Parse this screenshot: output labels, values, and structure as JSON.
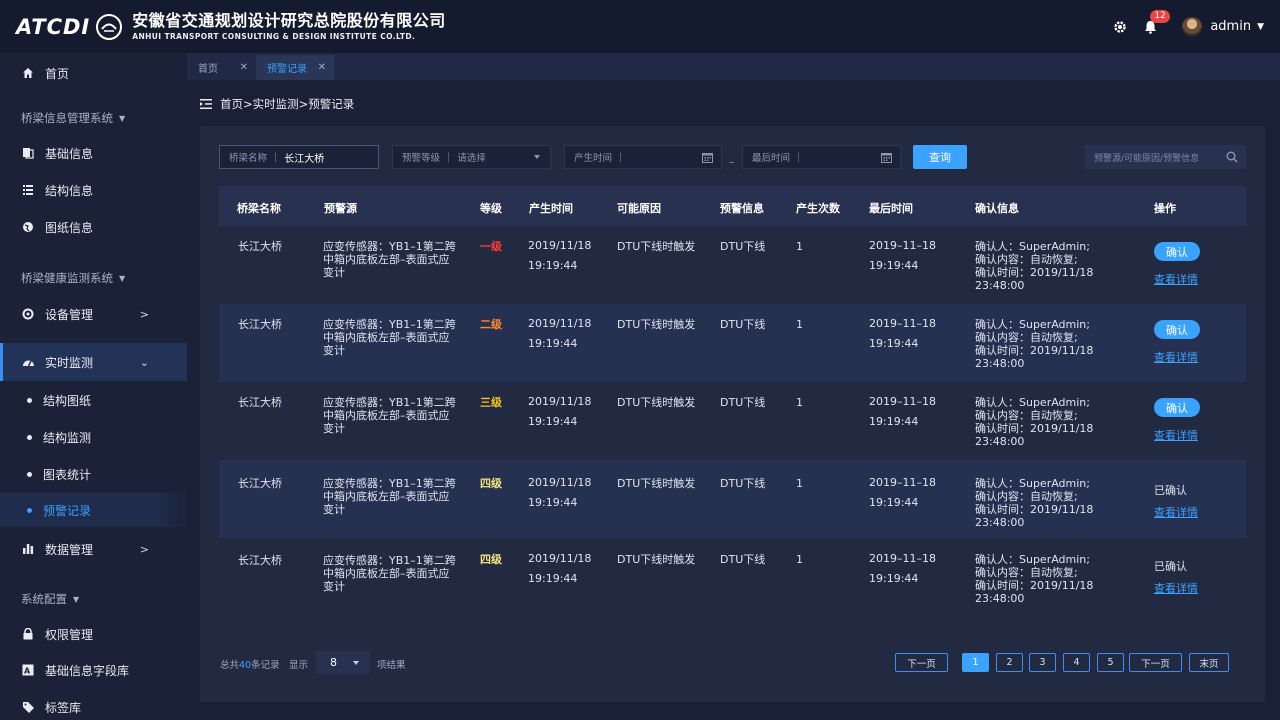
{
  "header": {
    "logo_text": "ATCDI",
    "company_cn": "安徽省交通规划设计研究总院股份有限公司",
    "company_en": "ANHUI TRANSPORT CONSULTING & DESIGN INSTITUTE CO.LTD.",
    "notification_count": "12",
    "username": "admin"
  },
  "sidebar": {
    "home": "首页",
    "group1": "桥梁信息管理系统",
    "basic_info": "基础信息",
    "structure_info": "结构信息",
    "drawing_info": "图纸信息",
    "group2": "桥梁健康监测系统",
    "device_mgmt": "设备管理",
    "realtime": "实时监测",
    "sub_items": [
      "结构图纸",
      "结构监测",
      "图表统计",
      "预警记录"
    ],
    "data_mgmt": "数据管理",
    "group3": "系统配置",
    "permission": "权限管理",
    "field_lib": "基础信息字段库",
    "tag_lib": "标签库"
  },
  "tabs": [
    {
      "label": "首页"
    },
    {
      "label": "预警记录"
    }
  ],
  "breadcrumb": "首页>实时监测>预警记录",
  "filters": {
    "bridge_label": "桥梁名称",
    "bridge_value": "长江大桥",
    "level_label": "预警等级",
    "level_placeholder": "请选择",
    "start_label": "产生时间",
    "end_label": "最后时间",
    "query_button": "查询",
    "search_placeholder": "预警源/可能原因/预警信息"
  },
  "table": {
    "headers": [
      "桥梁名称",
      "预警源",
      "等级",
      "产生时间",
      "可能原因",
      "预警信息",
      "产生次数",
      "最后时间",
      "确认信息",
      "操作"
    ],
    "rows": [
      {
        "bridge": "长江大桥",
        "source": [
          "应变传感器：YB1–1第二跨",
          "中箱内底板左部–表面式应",
          "变计"
        ],
        "level": "一级",
        "level_color": "#ff3b3b",
        "start": [
          "2019/11/18",
          "19:19:44"
        ],
        "reason": "DTU下线时触发",
        "info": "DTU下线",
        "count": "1",
        "last": [
          "2019–11–18",
          "19:19:44"
        ],
        "confirm": [
          "确认人：SuperAdmin;",
          "确认内容：自动恢复;",
          "确认时间：2019/11/18",
          "23:48:00"
        ],
        "action": "确认",
        "detail": "查看详情"
      },
      {
        "bridge": "长江大桥",
        "source": [
          "应变传感器：YB1–1第二跨",
          "中箱内底板左部–表面式应",
          "变计"
        ],
        "level": "二级",
        "level_color": "#ff8a2b",
        "start": [
          "2019/11/18",
          "19:19:44"
        ],
        "reason": "DTU下线时触发",
        "info": "DTU下线",
        "count": "1",
        "last": [
          "2019–11–18",
          "19:19:44"
        ],
        "confirm": [
          "确认人：SuperAdmin;",
          "确认内容：自动恢复;",
          "确认时间：2019/11/18",
          "23:48:00"
        ],
        "action": "确认",
        "detail": "查看详情"
      },
      {
        "bridge": "长江大桥",
        "source": [
          "应变传感器：YB1–1第二跨",
          "中箱内底板左部–表面式应",
          "变计"
        ],
        "level": "三级",
        "level_color": "#f5c518",
        "start": [
          "2019/11/18",
          "19:19:44"
        ],
        "reason": "DTU下线时触发",
        "info": "DTU下线",
        "count": "1",
        "last": [
          "2019–11–18",
          "19:19:44"
        ],
        "confirm": [
          "确认人：SuperAdmin;",
          "确认内容：自动恢复;",
          "确认时间：2019/11/18",
          "23:48:00"
        ],
        "action": "确认",
        "detail": "查看详情"
      },
      {
        "bridge": "长江大桥",
        "source": [
          "应变传感器：YB1–1第二跨",
          "中箱内底板左部–表面式应",
          "变计"
        ],
        "level": "四级",
        "level_color": "#f3e27a",
        "start": [
          "2019/11/18",
          "19:19:44"
        ],
        "reason": "DTU下线时触发",
        "info": "DTU下线",
        "count": "1",
        "last": [
          "2019–11–18",
          "19:19:44"
        ],
        "confirm": [
          "确认人：SuperAdmin;",
          "确认内容：自动恢复;",
          "确认时间：2019/11/18",
          "23:48:00"
        ],
        "action": "已确认",
        "detail": "查看详情"
      },
      {
        "bridge": "长江大桥",
        "source": [
          "应变传感器：YB1–1第二跨",
          "中箱内底板左部–表面式应",
          "变计"
        ],
        "level": "四级",
        "level_color": "#f3e27a",
        "start": [
          "2019/11/18",
          "19:19:44"
        ],
        "reason": "DTU下线时触发",
        "info": "DTU下线",
        "count": "1",
        "last": [
          "2019–11–18",
          "19:19:44"
        ],
        "confirm": [
          "确认人：SuperAdmin;",
          "确认内容：自动恢复;",
          "确认时间：2019/11/18",
          "23:48:00"
        ],
        "action": "已确认",
        "detail": "查看详情"
      }
    ]
  },
  "pagination": {
    "total_prefix": "总共",
    "total_count": "40",
    "total_suffix": "条记录",
    "show_label": "显示",
    "page_size": "8",
    "result_label": "项结果",
    "prev": "下一页",
    "pages": [
      "1",
      "2",
      "3",
      "4",
      "5"
    ],
    "next": "下一页",
    "last": "末页"
  },
  "colors": {
    "accent": "#3aa3ff",
    "background": "#1a2035",
    "panel": "#222a42"
  }
}
